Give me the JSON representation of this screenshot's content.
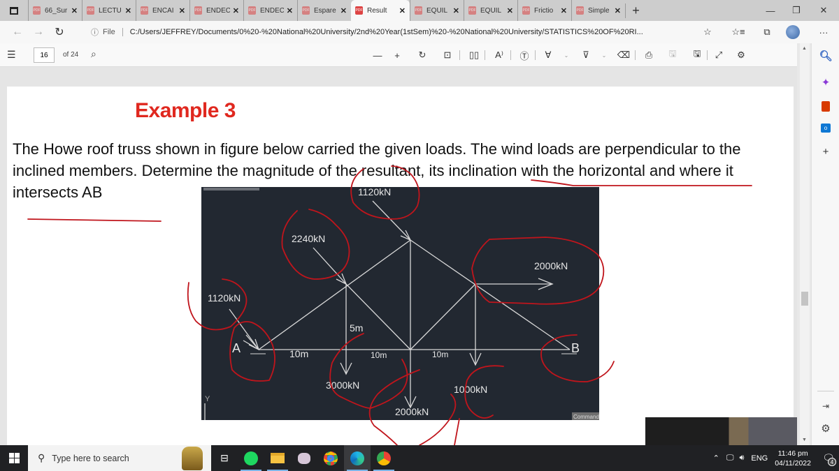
{
  "browser": {
    "tabs": [
      {
        "label": "66_Sur",
        "active": false
      },
      {
        "label": "LECTU",
        "active": false
      },
      {
        "label": "ENCAI",
        "active": false
      },
      {
        "label": "ENDEC",
        "active": false
      },
      {
        "label": "ENDEC",
        "active": false
      },
      {
        "label": "Espare",
        "active": false
      },
      {
        "label": "Result",
        "active": true
      },
      {
        "label": "EQUIL",
        "active": false
      },
      {
        "label": "EQUIL",
        "active": false
      },
      {
        "label": "Frictio",
        "active": false
      },
      {
        "label": "Simple",
        "active": false
      }
    ],
    "new_tab": "+",
    "window_controls": {
      "minimize": "—",
      "restore": "❐",
      "close": "✕"
    },
    "address": {
      "prefix": "File",
      "url": "C:/Users/JEFFREY/Documents/0%20-%20National%20University/2nd%20Year(1stSem)%20-%20National%20University/STATISTICS%20OF%20RI..."
    }
  },
  "pdf_toolbar": {
    "current_page": "16",
    "total_pages": "of 24"
  },
  "document": {
    "title": "Example 3",
    "paragraph": "The Howe roof truss shown in figure below carried the given loads. The wind loads are perpendicular to the inclined members. Determine the magnitude of the resultant, its inclination with the horizontal and where it intersects AB"
  },
  "diagram": {
    "loads": [
      {
        "label": "1120kN",
        "location": "apex, wind perpendicular to left member"
      },
      {
        "label": "2240kN",
        "location": "left upper panel point, wind"
      },
      {
        "label": "1120kN",
        "location": "support A, wind"
      },
      {
        "label": "2000kN",
        "location": "right upper panel point, horizontal"
      },
      {
        "label": "3000kN",
        "location": "left lower panel point, vertical down"
      },
      {
        "label": "2000kN",
        "location": "center lower joint, vertical down"
      },
      {
        "label": "1000kN",
        "location": "right lower panel point, vertical down"
      }
    ],
    "dimensions": {
      "height": "5m",
      "panels": [
        "10m",
        "10m",
        "10m"
      ]
    },
    "supports": {
      "left": "A",
      "right": "B"
    },
    "axis_label": "Y",
    "command_label": "Command",
    "colors": {
      "background": "#222831",
      "lines": "#d8d8d8",
      "annotation": "#c0151c"
    }
  },
  "taskbar": {
    "search_placeholder": "Type here to search",
    "tray": {
      "language": "ENG",
      "time": "11:46 pm",
      "date": "04/11/2022",
      "notifications": "4"
    }
  }
}
